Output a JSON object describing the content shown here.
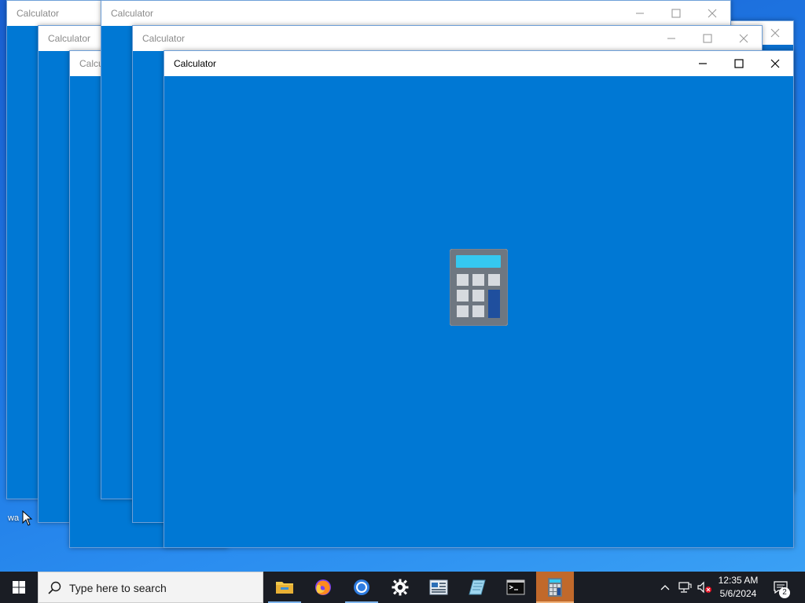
{
  "desktop": {
    "icon_label": "wa"
  },
  "windows": [
    {
      "id": "w1",
      "title": "Calculator"
    },
    {
      "id": "w2",
      "title": "Calculator"
    },
    {
      "id": "w3",
      "title": "Calculator"
    },
    {
      "id": "w4",
      "title": "Calculator"
    },
    {
      "id": "w5",
      "title": "Calculator"
    },
    {
      "id": "w6",
      "title": "Calculator"
    }
  ],
  "active_window": {
    "title": "Calculator",
    "splash_icon": "calculator-icon"
  },
  "taskbar": {
    "search_placeholder": "Type here to search",
    "apps": [
      {
        "name": "file-explorer-icon"
      },
      {
        "name": "firefox-icon"
      },
      {
        "name": "chrome-icon"
      },
      {
        "name": "settings-icon"
      },
      {
        "name": "news-icon"
      },
      {
        "name": "notepad-icon"
      },
      {
        "name": "terminal-icon"
      },
      {
        "name": "calculator-icon",
        "active": true
      }
    ],
    "clock": {
      "time": "12:35 AM",
      "date": "5/6/2024"
    },
    "notification_count": "2"
  },
  "colors": {
    "window_body": "#0078d4",
    "taskbar": "#1a1d24",
    "active_app": "#c1692b"
  }
}
